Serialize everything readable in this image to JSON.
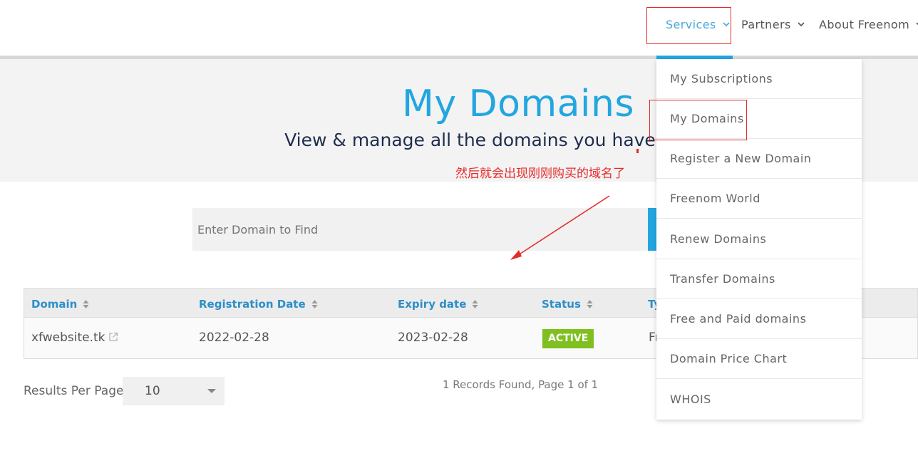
{
  "nav": {
    "services": "Services",
    "partners": "Partners",
    "about": "About Freenom"
  },
  "hero": {
    "title": "My Domains",
    "subtitle": "View & manage all the domains you have registered"
  },
  "annotation": {
    "text": "然后就会出现刚刚购买的域名了",
    "color": "#e62b2b"
  },
  "search": {
    "placeholder": "Enter Domain to Find"
  },
  "table": {
    "headers": [
      "Domain",
      "Registration Date",
      "Expiry date",
      "Status",
      "Ty"
    ],
    "rows": [
      {
        "domain": "xfwebsite.tk",
        "registration_date": "2022-02-28",
        "expiry_date": "2023-02-28",
        "status": "ACTIVE",
        "type": "Fr"
      }
    ]
  },
  "pagination": {
    "results_per_page_label": "Results Per Page:",
    "results_per_page_value": "10",
    "records_text": "1 Records Found, Page 1 of 1"
  },
  "services_menu": {
    "items": [
      "My Subscriptions",
      "My Domains",
      "Register a New Domain",
      "Freenom World",
      "Renew Domains",
      "Transfer Domains",
      "Free and Paid domains",
      "Domain Price Chart",
      "WHOIS"
    ]
  },
  "colors": {
    "brand": "#22a6e0",
    "active_badge": "#7fbf1f",
    "annotation": "#e62b2b"
  }
}
